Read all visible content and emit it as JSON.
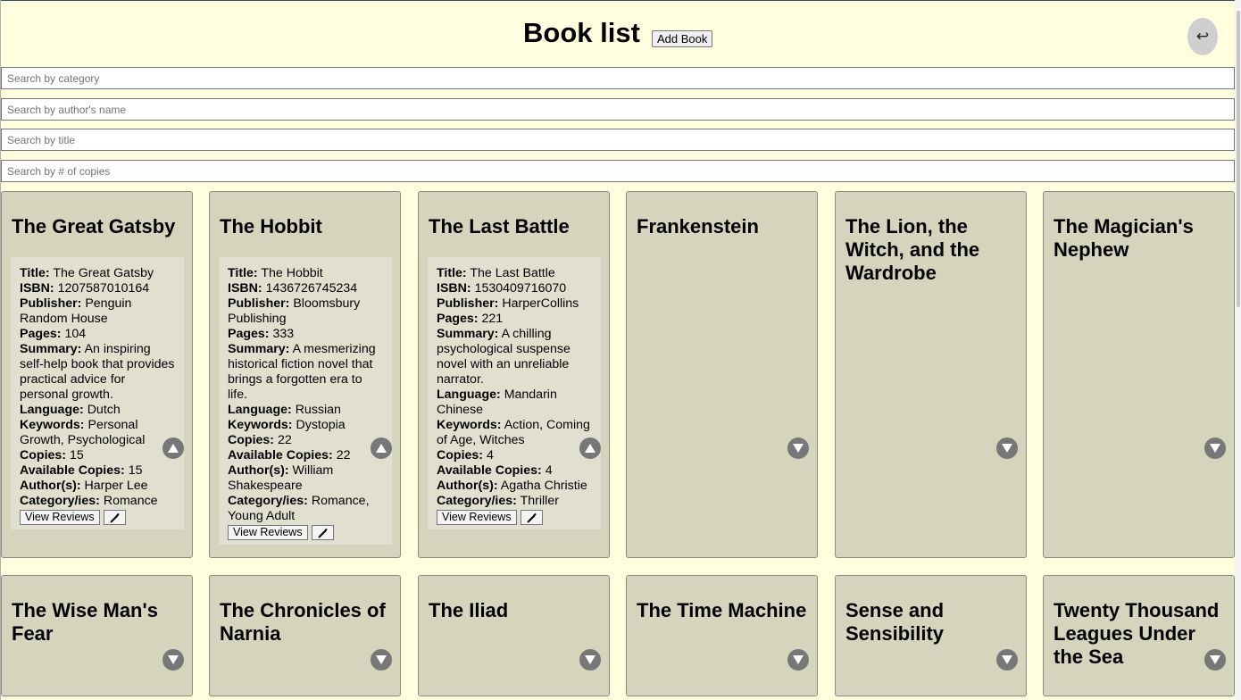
{
  "header": {
    "title": "Book list",
    "add_book_label": "Add Book",
    "back_icon": "↩"
  },
  "search": {
    "category_placeholder": "Search by category",
    "author_placeholder": "Search by author's name",
    "title_placeholder": "Search by title",
    "copies_placeholder": "Search by # of copies"
  },
  "labels": {
    "title": "Title:",
    "isbn": "ISBN:",
    "publisher": "Publisher:",
    "pages": "Pages:",
    "summary": "Summary:",
    "language": "Language:",
    "keywords": "Keywords:",
    "copies": "Copies:",
    "available": "Available Copies:",
    "authors": "Author(s):",
    "categories": "Category/ies:",
    "view_reviews": "View Reviews"
  },
  "books": [
    {
      "name": "The Great Gatsby",
      "expanded": true,
      "title": "The Great Gatsby",
      "isbn": "1207587010164",
      "publisher": "Penguin Random House",
      "pages": "104",
      "summary": "An inspiring self-help book that provides practical advice for personal growth.",
      "language": "Dutch",
      "keywords": "Personal Growth, Psychological",
      "copies": "15",
      "available": "15",
      "authors": "Harper Lee",
      "categories": "Romance"
    },
    {
      "name": "The Hobbit",
      "expanded": true,
      "title": "The Hobbit",
      "isbn": "1436726745234",
      "publisher": "Bloomsbury Publishing",
      "pages": "333",
      "summary": "A mesmerizing historical fiction novel that brings a forgotten era to life.",
      "language": "Russian",
      "keywords": "Dystopia",
      "copies": "22",
      "available": "22",
      "authors": "William Shakespeare",
      "categories": "Romance, Young Adult"
    },
    {
      "name": "The Last Battle",
      "expanded": true,
      "title": "The Last Battle",
      "isbn": "1530409716070",
      "publisher": "HarperCollins",
      "pages": "221",
      "summary": "A chilling psychological suspense novel with an unreliable narrator.",
      "language": "Mandarin Chinese",
      "keywords": "Action, Coming of Age, Witches",
      "copies": "4",
      "available": "4",
      "authors": "Agatha Christie",
      "categories": "Thriller"
    },
    {
      "name": "Frankenstein",
      "expanded": false
    },
    {
      "name": "The Lion, the Witch, and the Wardrobe",
      "expanded": false
    },
    {
      "name": "The Magician's Nephew",
      "expanded": false
    },
    {
      "name": "The Wise Man's Fear",
      "expanded": false
    },
    {
      "name": "The Chronicles of Narnia",
      "expanded": false
    },
    {
      "name": "The Iliad",
      "expanded": false
    },
    {
      "name": "The Time Machine",
      "expanded": false
    },
    {
      "name": "Sense and Sensibility",
      "expanded": false
    },
    {
      "name": "Twenty Thousand Leagues Under the Sea",
      "expanded": false
    }
  ]
}
